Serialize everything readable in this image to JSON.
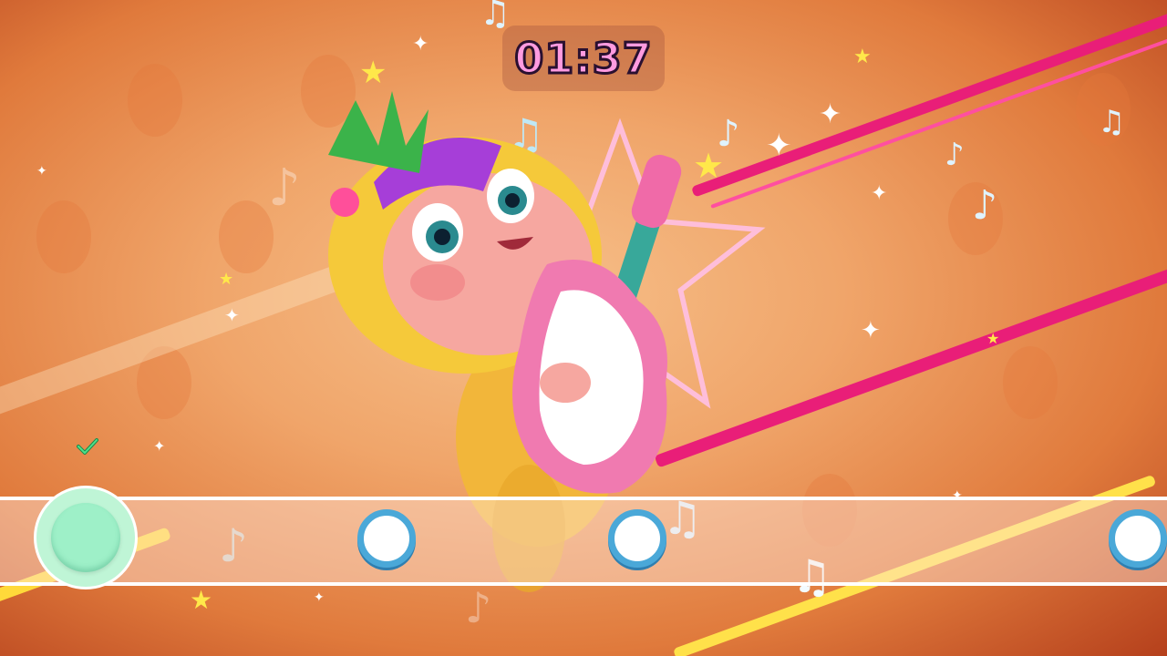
{
  "hud": {
    "timer": "01:37"
  },
  "track": {
    "hit_target_state": "hit",
    "notes_visible": 3
  },
  "colors": {
    "timer_text": "#ff9be0",
    "note_ring": "#4aa8d8",
    "hit_target": "#9ef0c8",
    "stripe_pink": "#e91e78",
    "stripe_yellow": "#ffe14a"
  },
  "icons": {
    "feedback": "check-icon",
    "decorations": [
      "music-note-icon",
      "star-icon",
      "sparkle-icon"
    ]
  }
}
